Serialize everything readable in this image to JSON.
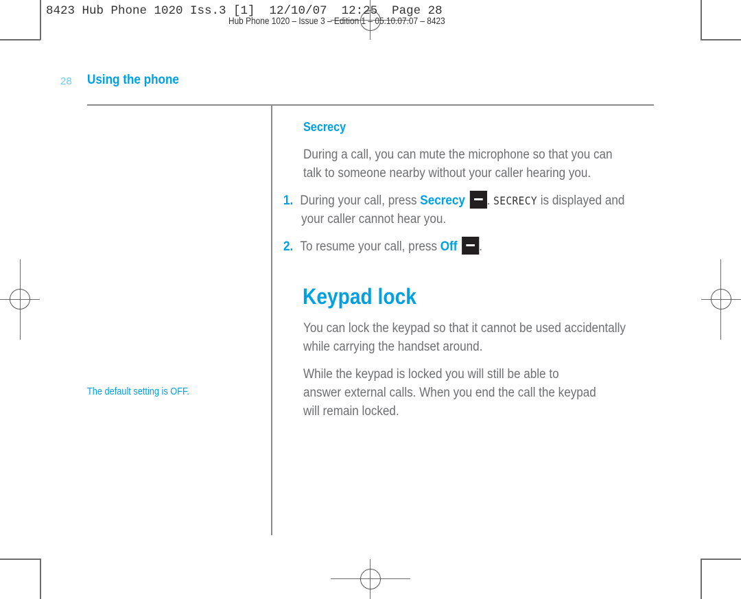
{
  "print_slug": {
    "line1": "8423 Hub Phone 1020 Iss.3 [1]  12/10/07  12:25  Page 28",
    "line2": "Hub Phone 1020 – Issue 3 – Edition 1 – 05.10.07.07 – 8423"
  },
  "header": {
    "page_number": "28",
    "section_title": "Using the phone"
  },
  "sidebar": {
    "note": "The default setting is OFF."
  },
  "secrecy": {
    "heading": "Secrecy",
    "intro_line1": "During a call, you can mute the microphone so that you can",
    "intro_line2": "talk to someone nearby without your caller hearing you.",
    "steps": [
      {
        "number": "1.",
        "text_before": "During your call, press ",
        "key_label": "Secrecy",
        "key_icon": "minus-softkey-icon",
        "text_middle": ". ",
        "display_text": "SECRECY",
        "text_after": " is displayed and",
        "line2": "your caller cannot hear you."
      },
      {
        "number": "2.",
        "text_before": "To resume your call, press ",
        "key_label": "Off",
        "key_icon": "minus-softkey-icon",
        "text_after": "."
      }
    ]
  },
  "keypad_lock": {
    "heading": "Keypad lock",
    "para1_line1": "You can lock the keypad so that it cannot be used accidentally",
    "para1_line2": "while carrying the handset around.",
    "para2_line1": "While the keypad is locked you will still be able to",
    "para2_line2": "answer external calls. When you end the call the keypad",
    "para2_line3": "will remain locked."
  },
  "colors": {
    "accent": "#00a0e2",
    "body_text": "#6d6e71",
    "page_number": "#6fcdf2",
    "softkey": "#231f20"
  }
}
